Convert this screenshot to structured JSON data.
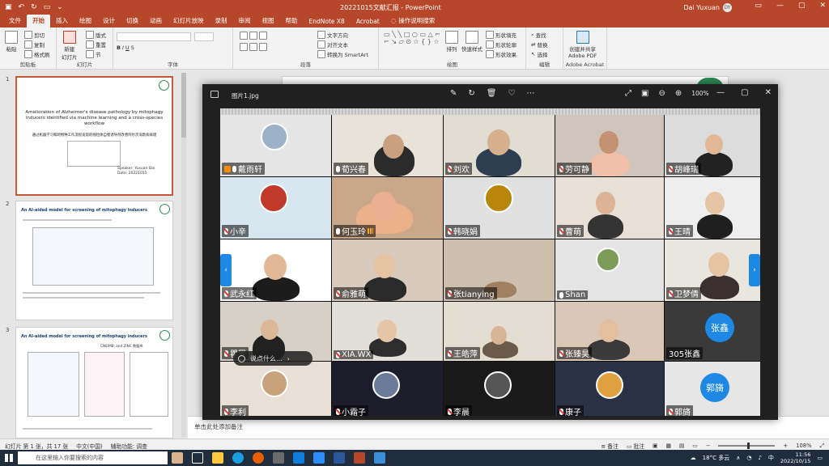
{
  "titlebar": {
    "doc_title": "20221015文献汇报  -  PowerPoint",
    "user_name": "Dai Yuxuan",
    "user_initials": "DY"
  },
  "tabs": [
    "文件",
    "开始",
    "插入",
    "绘图",
    "设计",
    "切换",
    "动画",
    "幻灯片放映",
    "录制",
    "审阅",
    "视图",
    "帮助",
    "EndNote X8",
    "Acrobat"
  ],
  "tab_search": "操作说明搜索",
  "ribbon": {
    "paste": "粘贴",
    "cut": "剪切",
    "copy": "复制",
    "format_painter": "格式刷",
    "clipboard": "剪贴板",
    "new_slide": "新建\n幻灯片",
    "layout": "版式",
    "reset": "重置",
    "section": "节",
    "slides": "幻灯片",
    "font": "字体",
    "text_direction": "文字方向",
    "align_text": "对齐文本",
    "smartart": "转换为 SmartArt",
    "paragraph": "段落",
    "arrange": "排列",
    "quick_styles": "快速样式",
    "shape_fill": "形状填充",
    "shape_outline": "形状轮廓",
    "shape_effect": "形状效果",
    "drawing": "绘图",
    "find": "查找",
    "replace": "替换",
    "select": "选择",
    "editing": "编辑",
    "adobe_create": "创建并共享\nAdobe PDF",
    "adobe_acrobat": "Adobe Acrobat"
  },
  "thumbs": [
    {
      "num": "1",
      "title_en": "Amelioration of Alzheimer's disease pathology by mitophagy inducers identified via machine learning and a cross-species workflow",
      "title_cn": "通过机器学习和跨物种工作流程发现的线粒体自噬诱导剂改善阿尔茨海默病病理",
      "speaker_label": "Speaker:",
      "speaker": "Yuxuan Dai",
      "date_label": "Date:",
      "date": "20221015"
    },
    {
      "num": "2",
      "heading": "An AI-aided model for screening of mitophagy inducers"
    },
    {
      "num": "3",
      "heading": "An AI-aided model for screening of mitophagy inducers",
      "sub": "CNS/MB, and ZINC 数据库"
    }
  ],
  "notes_placeholder": "单击此处添加备注",
  "viewer": {
    "filename": "图片1.jpg",
    "zoom": "100%"
  },
  "participants": [
    {
      "name": "戴雨轩",
      "mic": "host"
    },
    {
      "name": "荀兴春",
      "mic": "on"
    },
    {
      "name": "刘欢",
      "mic": "muted"
    },
    {
      "name": "劳可静",
      "mic": "muted"
    },
    {
      "name": "胡峰瑞",
      "mic": "muted"
    },
    {
      "name": "小辛",
      "mic": "muted"
    },
    {
      "name": "何玉玲",
      "mic": "speaking"
    },
    {
      "name": "韩晓娟",
      "mic": "muted"
    },
    {
      "name": "曹萌",
      "mic": "muted"
    },
    {
      "name": "王晴",
      "mic": "muted"
    },
    {
      "name": "武永红",
      "mic": "muted"
    },
    {
      "name": "俞雅萌",
      "mic": "muted"
    },
    {
      "name": "张tianying",
      "mic": "muted"
    },
    {
      "name": "Shan",
      "mic": "on"
    },
    {
      "name": "卫梦倩",
      "mic": "muted"
    },
    {
      "name": "瞿罗",
      "mic": "muted"
    },
    {
      "name": "XIA.WX",
      "mic": "muted"
    },
    {
      "name": "王皓萍",
      "mic": "muted"
    },
    {
      "name": "张臻昊",
      "mic": "muted"
    },
    {
      "name": "305张鑫",
      "mic": "none",
      "badge": "张鑫"
    },
    {
      "name": "李利",
      "mic": "muted"
    },
    {
      "name": "小霜子",
      "mic": "muted"
    },
    {
      "name": "李晨",
      "mic": "muted"
    },
    {
      "name": "康子",
      "mic": "muted"
    },
    {
      "name": "郭旖",
      "mic": "muted",
      "badge": "郭旖"
    }
  ],
  "chat_placeholder": "说点什么...",
  "status": {
    "slide_info": "幻灯片 第 1 张，共 17 张",
    "language": "中文(中国)",
    "accessibility": "辅助功能: 调查",
    "notes": "备注",
    "comments": "批注",
    "zoom": "108%"
  },
  "taskbar": {
    "search_placeholder": "在这里输入你要搜索的内容",
    "weather": "18°C 多云",
    "time": "11:56",
    "date": "2022/10/15",
    "ime": "中"
  },
  "colors": {
    "ppt_accent": "#b7472a",
    "zoom_blue": "#1e88e5",
    "taskbar": "#1f2d3d"
  }
}
